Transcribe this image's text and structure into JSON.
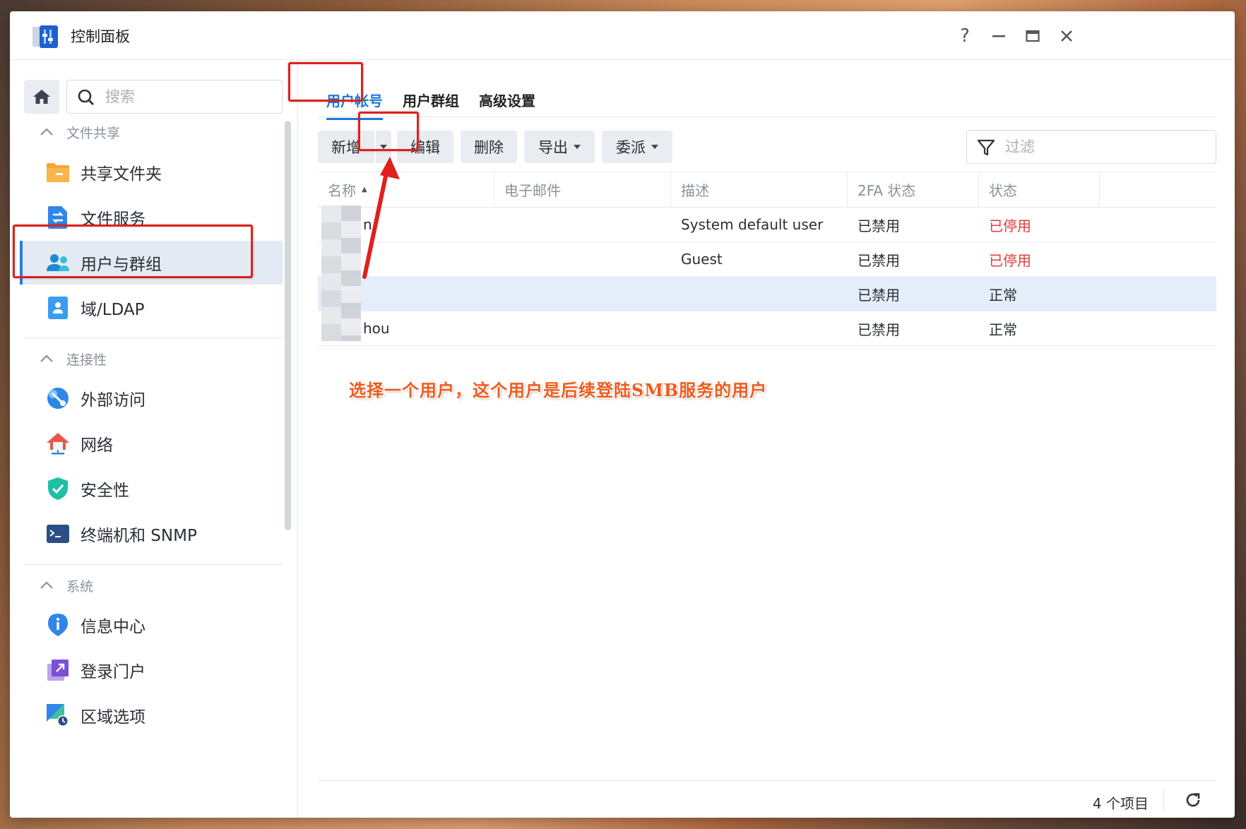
{
  "window": {
    "title": "控制面板",
    "controls": [
      "?",
      "—",
      "□",
      "✕"
    ]
  },
  "sidebar": {
    "search_placeholder": "搜索",
    "sections": [
      {
        "title": "文件共享",
        "items": [
          "共享文件夹",
          "文件服务",
          "用户与群组",
          "域/LDAP"
        ]
      },
      {
        "title": "连接性",
        "items": [
          "外部访问",
          "网络",
          "安全性",
          "终端机和 SNMP"
        ]
      },
      {
        "title": "系统",
        "items": [
          "信息中心",
          "登录门户",
          "区域选项"
        ]
      }
    ],
    "active_item": "用户与群组"
  },
  "tabs": [
    "用户帐号",
    "用户群组",
    "高级设置"
  ],
  "active_tab": "用户帐号",
  "toolbar": {
    "add": "新增",
    "edit": "编辑",
    "delete": "删除",
    "export": "导出",
    "delegate": "委派",
    "filter_placeholder": "过滤"
  },
  "table": {
    "columns": [
      "名称",
      "电子邮件",
      "描述",
      "2FA 状态",
      "状态"
    ],
    "sort_indicator": "▲",
    "rows": [
      {
        "name": "n",
        "email": "",
        "desc": "System default user",
        "twofa": "已禁用",
        "status": "已停用"
      },
      {
        "name": "",
        "email": "",
        "desc": "Guest",
        "twofa": "已禁用",
        "status": "已停用"
      },
      {
        "name": "",
        "email": "",
        "desc": "",
        "twofa": "已禁用",
        "status": "正常"
      },
      {
        "name": "hou",
        "email": "",
        "desc": "",
        "twofa": "已禁用",
        "status": "正常"
      }
    ],
    "selected_row": 2
  },
  "annotation": "选择一个用户，这个用户是后续登陆SMB服务的用户",
  "footer": {
    "count": "4 个项目"
  },
  "colors": {
    "accent": "#1a7ae0",
    "disabled_status": "#e23a3a",
    "annotation": "#f05a1c",
    "highlight_box": "#e0201c"
  }
}
